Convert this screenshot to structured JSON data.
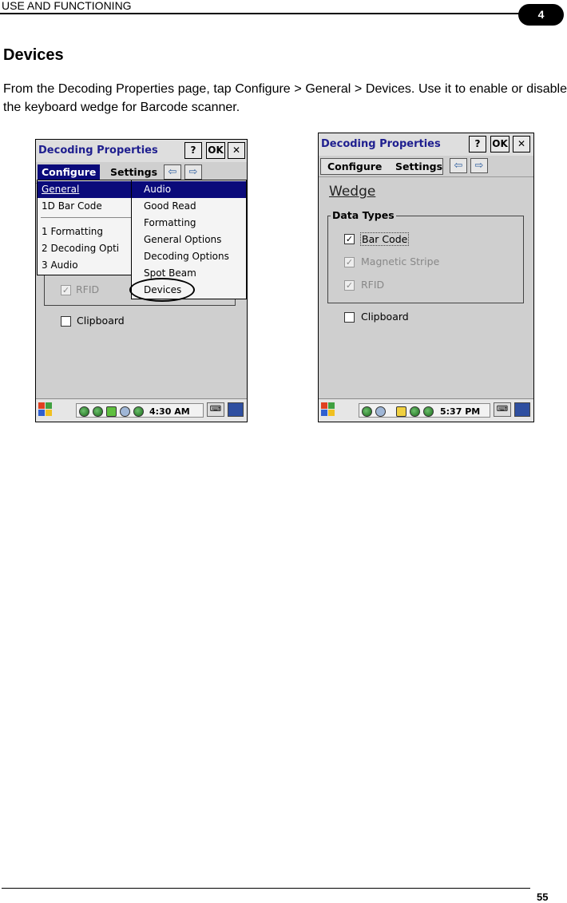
{
  "header": {
    "title": "USE AND FUNCTIONING",
    "chapter": "4"
  },
  "section_title": "Devices",
  "body_text": "From the Decoding Properties page, tap Configure > General > Devices. Use it to enable or disable the keyboard wedge for Barcode scanner.",
  "page_number": "55",
  "screen1": {
    "title": "Decoding Properties",
    "help_btn": "?",
    "ok_btn": "OK",
    "close_btn": "✕",
    "menu_tabs": [
      "Configure",
      "Settings"
    ],
    "arrow_left": "⇦",
    "arrow_right": "⇨",
    "configure_menu": [
      "General",
      "1D Bar Code",
      "1 Formatting",
      "2 Decoding Opti",
      "3 Audio"
    ],
    "general_submenu": [
      "Audio",
      "Good Read",
      "Formatting",
      "General Options",
      "Decoding Options",
      "Spot Beam",
      "Devices"
    ],
    "rfid_label": "RFID",
    "clipboard_label": "Clipboard",
    "clock": "4:30 AM"
  },
  "screen2": {
    "title": "Decoding Properties",
    "help_btn": "?",
    "ok_btn": "OK",
    "close_btn": "✕",
    "menu_tabs": [
      "Configure",
      "Settings"
    ],
    "arrow_left": "⇦",
    "arrow_right": "⇨",
    "heading": "Wedge",
    "group_title": "Data Types",
    "checkboxes": [
      {
        "label": "Bar Code",
        "checked": true,
        "enabled": true
      },
      {
        "label": "Magnetic Stripe",
        "checked": true,
        "enabled": false
      },
      {
        "label": "RFID",
        "checked": true,
        "enabled": false
      }
    ],
    "clipboard_label": "Clipboard",
    "clock": "5:37 PM"
  }
}
